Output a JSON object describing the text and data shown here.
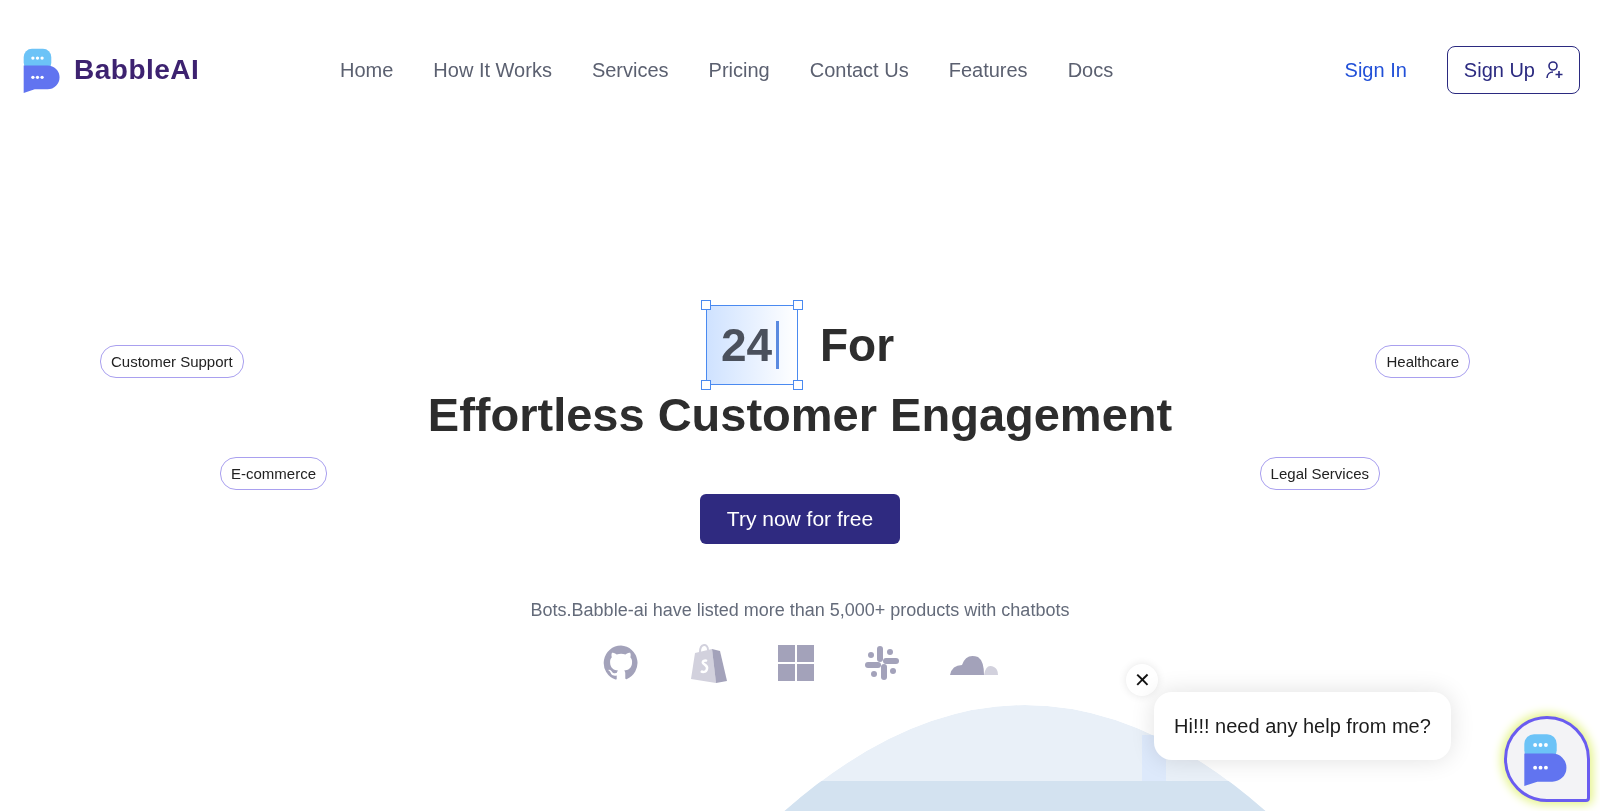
{
  "header": {
    "logo": "BabbleAI",
    "nav": [
      "Home",
      "How It Works",
      "Services",
      "Pricing",
      "Contact Us",
      "Features",
      "Docs"
    ],
    "sign_in": "Sign In",
    "sign_up": "Sign Up"
  },
  "hero": {
    "typed_word": "24",
    "title_rest": "For",
    "title_line2": "Effortless Customer Engagement",
    "tags": [
      "Customer Support",
      "Healthcare",
      "E-commerce",
      "Legal Services"
    ],
    "cta": "Try now for free",
    "subtitle": "Bots.Babble-ai have listed more than 5,000+ products with chatbots"
  },
  "chat": {
    "message": "Hi!!! need any help from me?",
    "close": "✕"
  }
}
